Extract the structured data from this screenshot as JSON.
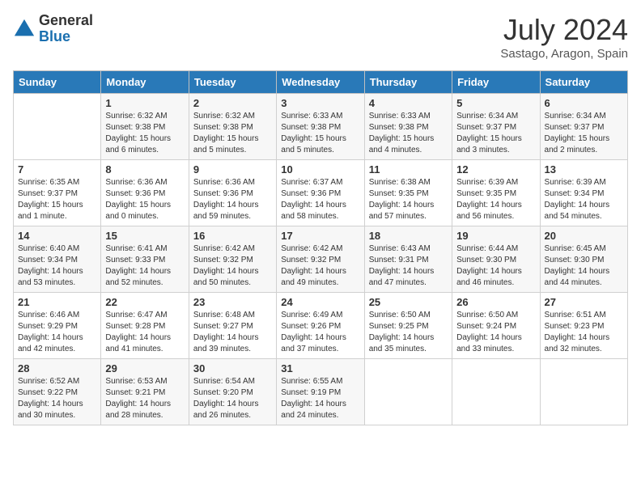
{
  "logo": {
    "general": "General",
    "blue": "Blue"
  },
  "title": {
    "month_year": "July 2024",
    "location": "Sastago, Aragon, Spain"
  },
  "days_of_week": [
    "Sunday",
    "Monday",
    "Tuesday",
    "Wednesday",
    "Thursday",
    "Friday",
    "Saturday"
  ],
  "weeks": [
    [
      {
        "day": "",
        "content": ""
      },
      {
        "day": "1",
        "content": "Sunrise: 6:32 AM\nSunset: 9:38 PM\nDaylight: 15 hours\nand 6 minutes."
      },
      {
        "day": "2",
        "content": "Sunrise: 6:32 AM\nSunset: 9:38 PM\nDaylight: 15 hours\nand 5 minutes."
      },
      {
        "day": "3",
        "content": "Sunrise: 6:33 AM\nSunset: 9:38 PM\nDaylight: 15 hours\nand 5 minutes."
      },
      {
        "day": "4",
        "content": "Sunrise: 6:33 AM\nSunset: 9:38 PM\nDaylight: 15 hours\nand 4 minutes."
      },
      {
        "day": "5",
        "content": "Sunrise: 6:34 AM\nSunset: 9:37 PM\nDaylight: 15 hours\nand 3 minutes."
      },
      {
        "day": "6",
        "content": "Sunrise: 6:34 AM\nSunset: 9:37 PM\nDaylight: 15 hours\nand 2 minutes."
      }
    ],
    [
      {
        "day": "7",
        "content": "Sunrise: 6:35 AM\nSunset: 9:37 PM\nDaylight: 15 hours\nand 1 minute."
      },
      {
        "day": "8",
        "content": "Sunrise: 6:36 AM\nSunset: 9:36 PM\nDaylight: 15 hours\nand 0 minutes."
      },
      {
        "day": "9",
        "content": "Sunrise: 6:36 AM\nSunset: 9:36 PM\nDaylight: 14 hours\nand 59 minutes."
      },
      {
        "day": "10",
        "content": "Sunrise: 6:37 AM\nSunset: 9:36 PM\nDaylight: 14 hours\nand 58 minutes."
      },
      {
        "day": "11",
        "content": "Sunrise: 6:38 AM\nSunset: 9:35 PM\nDaylight: 14 hours\nand 57 minutes."
      },
      {
        "day": "12",
        "content": "Sunrise: 6:39 AM\nSunset: 9:35 PM\nDaylight: 14 hours\nand 56 minutes."
      },
      {
        "day": "13",
        "content": "Sunrise: 6:39 AM\nSunset: 9:34 PM\nDaylight: 14 hours\nand 54 minutes."
      }
    ],
    [
      {
        "day": "14",
        "content": "Sunrise: 6:40 AM\nSunset: 9:34 PM\nDaylight: 14 hours\nand 53 minutes."
      },
      {
        "day": "15",
        "content": "Sunrise: 6:41 AM\nSunset: 9:33 PM\nDaylight: 14 hours\nand 52 minutes."
      },
      {
        "day": "16",
        "content": "Sunrise: 6:42 AM\nSunset: 9:32 PM\nDaylight: 14 hours\nand 50 minutes."
      },
      {
        "day": "17",
        "content": "Sunrise: 6:42 AM\nSunset: 9:32 PM\nDaylight: 14 hours\nand 49 minutes."
      },
      {
        "day": "18",
        "content": "Sunrise: 6:43 AM\nSunset: 9:31 PM\nDaylight: 14 hours\nand 47 minutes."
      },
      {
        "day": "19",
        "content": "Sunrise: 6:44 AM\nSunset: 9:30 PM\nDaylight: 14 hours\nand 46 minutes."
      },
      {
        "day": "20",
        "content": "Sunrise: 6:45 AM\nSunset: 9:30 PM\nDaylight: 14 hours\nand 44 minutes."
      }
    ],
    [
      {
        "day": "21",
        "content": "Sunrise: 6:46 AM\nSunset: 9:29 PM\nDaylight: 14 hours\nand 42 minutes."
      },
      {
        "day": "22",
        "content": "Sunrise: 6:47 AM\nSunset: 9:28 PM\nDaylight: 14 hours\nand 41 minutes."
      },
      {
        "day": "23",
        "content": "Sunrise: 6:48 AM\nSunset: 9:27 PM\nDaylight: 14 hours\nand 39 minutes."
      },
      {
        "day": "24",
        "content": "Sunrise: 6:49 AM\nSunset: 9:26 PM\nDaylight: 14 hours\nand 37 minutes."
      },
      {
        "day": "25",
        "content": "Sunrise: 6:50 AM\nSunset: 9:25 PM\nDaylight: 14 hours\nand 35 minutes."
      },
      {
        "day": "26",
        "content": "Sunrise: 6:50 AM\nSunset: 9:24 PM\nDaylight: 14 hours\nand 33 minutes."
      },
      {
        "day": "27",
        "content": "Sunrise: 6:51 AM\nSunset: 9:23 PM\nDaylight: 14 hours\nand 32 minutes."
      }
    ],
    [
      {
        "day": "28",
        "content": "Sunrise: 6:52 AM\nSunset: 9:22 PM\nDaylight: 14 hours\nand 30 minutes."
      },
      {
        "day": "29",
        "content": "Sunrise: 6:53 AM\nSunset: 9:21 PM\nDaylight: 14 hours\nand 28 minutes."
      },
      {
        "day": "30",
        "content": "Sunrise: 6:54 AM\nSunset: 9:20 PM\nDaylight: 14 hours\nand 26 minutes."
      },
      {
        "day": "31",
        "content": "Sunrise: 6:55 AM\nSunset: 9:19 PM\nDaylight: 14 hours\nand 24 minutes."
      },
      {
        "day": "",
        "content": ""
      },
      {
        "day": "",
        "content": ""
      },
      {
        "day": "",
        "content": ""
      }
    ]
  ]
}
